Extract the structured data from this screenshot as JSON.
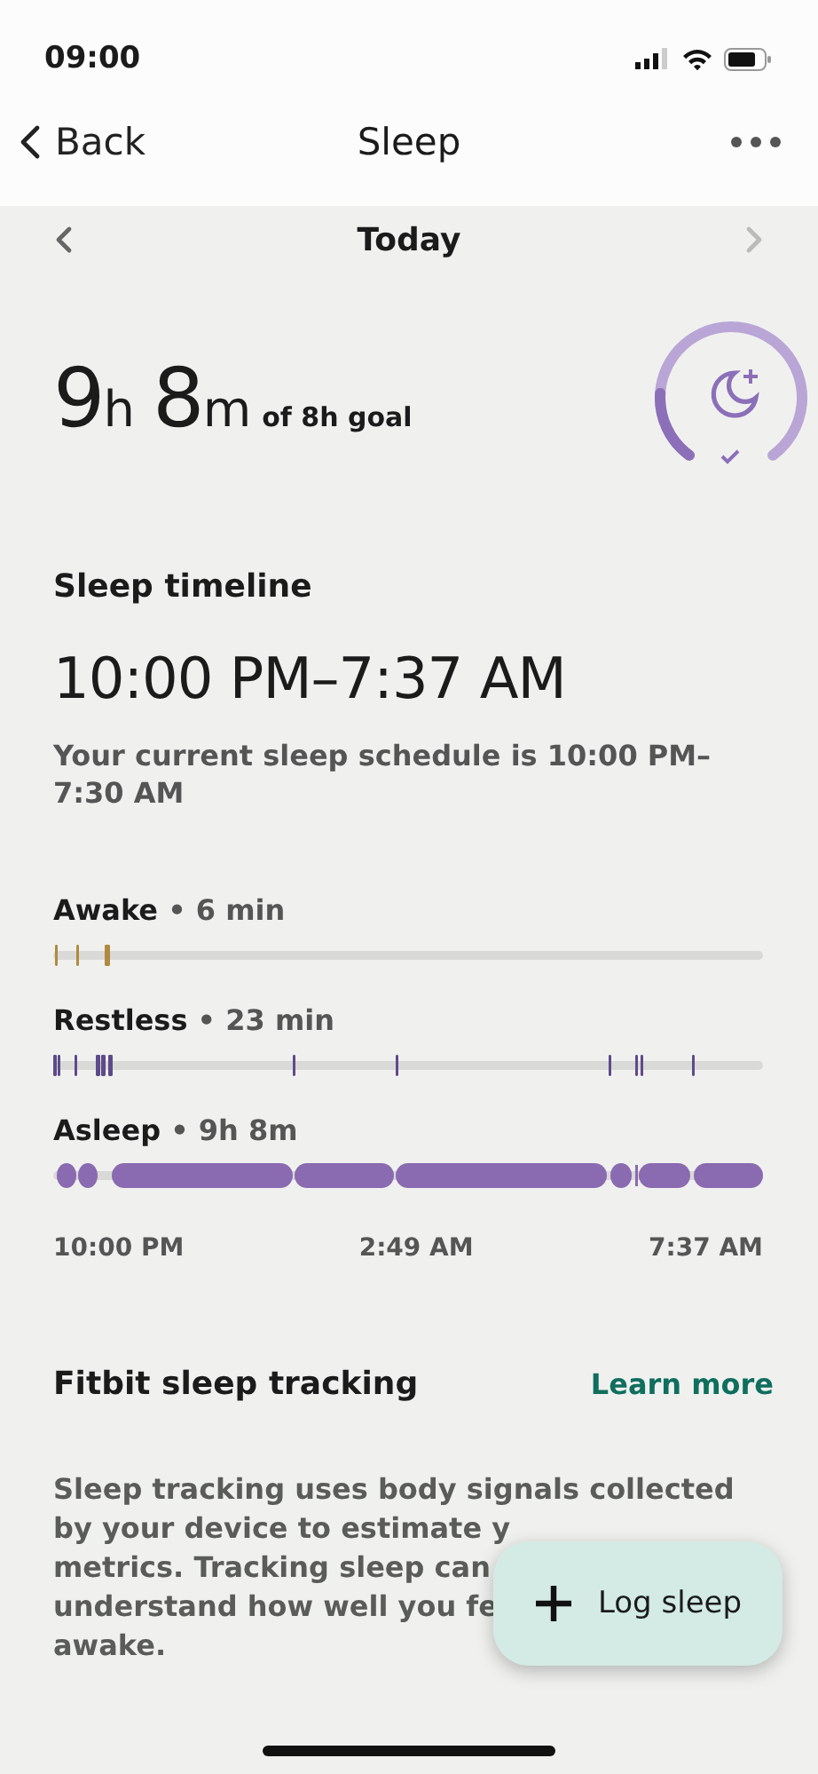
{
  "status_bar": {
    "time": "09:00"
  },
  "nav": {
    "back": "Back",
    "title": "Sleep"
  },
  "date_nav": {
    "label": "Today",
    "next_disabled": true
  },
  "summary": {
    "hours": "9",
    "hours_unit": "h",
    "minutes": "8",
    "minutes_unit": "m",
    "goal": "of 8h goal"
  },
  "timeline": {
    "title": "Sleep timeline",
    "range": "10:00 PM–7:37 AM",
    "schedule": "Your current sleep schedule is 10:00 PM–7:30 AM",
    "stages": [
      {
        "kind": "awake",
        "name": "Awake",
        "duration": "• 6 min",
        "color": "#b08a3e"
      },
      {
        "kind": "restless",
        "name": "Restless",
        "duration": "• 23 min",
        "color": "#5e4a8a"
      },
      {
        "kind": "asleep",
        "name": "Asleep",
        "duration": "• 9h 8m",
        "color": "#8a6ab0"
      }
    ],
    "axis": [
      "10:00 PM",
      "2:49 AM",
      "7:37 AM"
    ]
  },
  "tracking": {
    "title": "Fitbit sleep tracking",
    "link": "Learn more",
    "lines": [
      "Sleep tracking uses body signals collected",
      "by your device to estimate y",
      "metrics. Tracking sleep can",
      "understand how well you fe",
      "awake."
    ]
  },
  "fab": {
    "label": "Log sleep"
  }
}
